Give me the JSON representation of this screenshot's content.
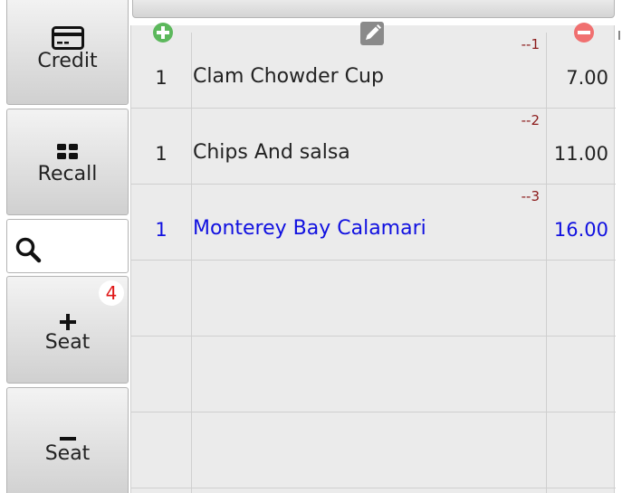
{
  "sidebar": {
    "credit": {
      "label": "Credit",
      "icon": "credit-card-icon"
    },
    "recall": {
      "label": "Recall",
      "icon": "grid-icon"
    },
    "search": {
      "icon": "search-icon"
    },
    "add_seat": {
      "label": "Seat",
      "icon": "plus-icon",
      "badge": "4"
    },
    "remove_seat": {
      "label": "Seat",
      "icon": "minus-icon"
    }
  },
  "order": {
    "header_icons": {
      "add": "plus-circle-icon",
      "edit": "pencil-icon",
      "remove": "minus-circle-icon"
    },
    "items": [
      {
        "line_number": "--1",
        "qty": "1",
        "name": "Clam Chowder Cup",
        "price": "7.00",
        "selected": false
      },
      {
        "line_number": "--2",
        "qty": "1",
        "name": "Chips And salsa",
        "price": "11.00",
        "selected": false
      },
      {
        "line_number": "--3",
        "qty": "1",
        "name": "Monterey Bay Calamari",
        "price": "16.00",
        "selected": true
      },
      {
        "line_number": "",
        "qty": "",
        "name": "",
        "price": "",
        "selected": false
      },
      {
        "line_number": "",
        "qty": "",
        "name": "",
        "price": "",
        "selected": false
      },
      {
        "line_number": "",
        "qty": "",
        "name": "",
        "price": "",
        "selected": false
      }
    ]
  },
  "colors": {
    "selected_text": "#1010e0",
    "line_number": "#8b1a1a",
    "badge": "#e01818",
    "add_icon": "#5cb85c",
    "remove_icon": "#f07070"
  }
}
